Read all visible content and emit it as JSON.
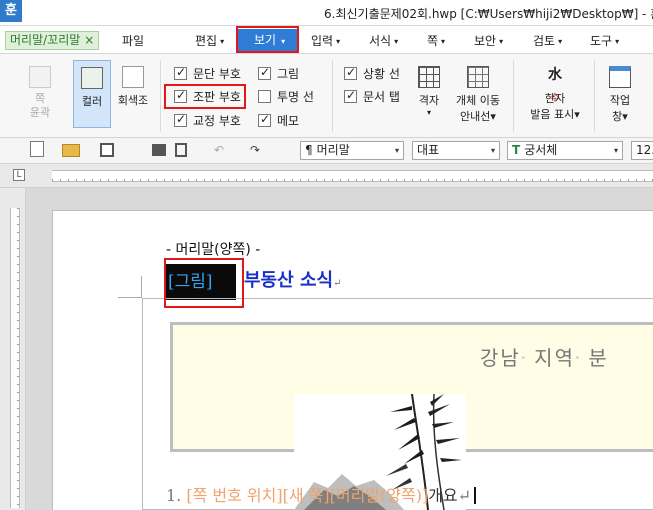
{
  "window": {
    "app_icon_glyph": "훈",
    "title": "6.최신기출문제02회.hwp [C:₩Users₩hiji2₩Desktop₩] - 훈"
  },
  "menu": {
    "context_tab": "머리말/꼬리말",
    "context_close": "×",
    "items": [
      "파일",
      "편집",
      "보기",
      "입력",
      "서식",
      "쪽",
      "보안",
      "검토",
      "도구"
    ],
    "active": "보기",
    "caret": "▾"
  },
  "ribbon": {
    "page_outline": "쪽\n윤곽",
    "color": "컬러",
    "grayscale": "회색조",
    "checkboxes": {
      "paragraph_mark": {
        "label": "문단 부호",
        "checked": true
      },
      "layout_mark": {
        "label": "조판 부호",
        "checked": true
      },
      "proofread_mark": {
        "label": "교정 부호",
        "checked": true
      },
      "picture": {
        "label": "그림",
        "checked": true
      },
      "transparent_line": {
        "label": "투명 선",
        "checked": false
      },
      "memo": {
        "label": "메모",
        "checked": true
      },
      "status_bar": {
        "label": "상황 선",
        "checked": true
      },
      "doc_tabs": {
        "label": "문서 탭",
        "checked": true
      }
    },
    "grid": "격자",
    "grid_caret": "▾",
    "object_move": "개체 이동",
    "object_move_sub": "안내선▾",
    "hanja": "한자",
    "hanja_sub": "발음 표시▾",
    "hanja_glyph": "水",
    "hanja_small": "수",
    "work_window": "작업",
    "work_window_sub": "창▾"
  },
  "toolbar": {
    "style_value": "머리말",
    "style_icon": "¶",
    "language_value": "대표",
    "font_value": "궁서체",
    "font_icon": "T",
    "size_value": "12."
  },
  "document": {
    "header_label": "- 머리말(양쪽) -",
    "picture_mark": "[그림]",
    "headline": "부동산 소식",
    "return_mark": "↵",
    "yellow_title_a": "강남",
    "yellow_title_b": "지역",
    "yellow_title_c": "분",
    "space_mark": "ˇ",
    "list_number": "1.",
    "list_field": "[쪽 번호 위치][새 쪽][머리말(양쪽)]",
    "list_text": "개요"
  },
  "colors": {
    "accent": "#2e7cd6",
    "highlight_red": "#e01818",
    "headline_blue": "#1a2ec8",
    "field_orange": "#f0a36c",
    "yellow_fill": "#fffde6"
  }
}
